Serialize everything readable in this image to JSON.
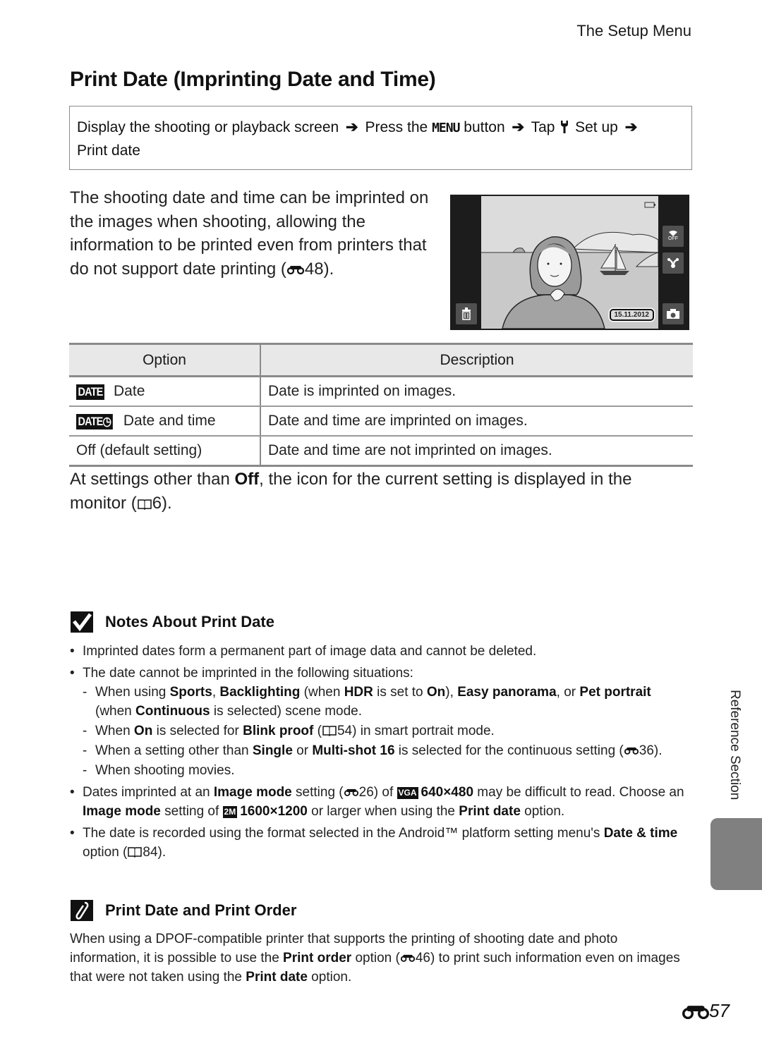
{
  "header": {
    "running_head": "The Setup Menu",
    "title": "Print Date (Imprinting Date and Time)"
  },
  "navigation": {
    "step1": "Display the shooting or playback screen",
    "step2_pre": "Press the",
    "menu_button": "MENU",
    "step2_post": "button",
    "step3_pre": "Tap",
    "step3_post": "Set up",
    "step4": "Print date",
    "icons": [
      "arrow-right-icon",
      "wrench-icon"
    ]
  },
  "intro": {
    "text": "The shooting date and time can be imprinted on the images when shooting, allowing the information to be printed even from printers that do not support date printing (",
    "ref": "48",
    "end": ")."
  },
  "camera_screen": {
    "date_stamp": "15.11.2012",
    "icons": [
      "battery-icon",
      "wifi-off-icon",
      "share-icon",
      "trash-icon",
      "camera-shutter-icon"
    ],
    "wifi_label": "OFF"
  },
  "table": {
    "headers": [
      "Option",
      "Description"
    ],
    "rows": [
      {
        "icon": "DATE",
        "option": "Date",
        "description": "Date is imprinted on images."
      },
      {
        "icon": "DATE◷",
        "option": "Date and time",
        "description": "Date and time are imprinted on images."
      },
      {
        "icon": "",
        "option": "Off (default setting)",
        "description": "Date and time are not imprinted on images."
      }
    ]
  },
  "para2": {
    "pre": "At settings other than ",
    "bold": "Off",
    "post": ", the icon for the current setting is displayed in the monitor (",
    "ref": "6",
    "end": ")."
  },
  "notes": {
    "heading": "Notes About Print Date",
    "b1": "Imprinted dates form a permanent part of image data and cannot be deleted.",
    "b2": "The date cannot be imprinted in the following situations:",
    "s1": {
      "t1": "When using ",
      "b1": "Sports",
      "t2": ", ",
      "b2": "Backlighting",
      "t3": " (when ",
      "b3": "HDR",
      "t4": " is set to ",
      "b4": "On",
      "t5": "), ",
      "b5": "Easy panorama",
      "t6": ", or ",
      "b6": "Pet portrait",
      "t7": " (when ",
      "b7": "Continuous",
      "t8": " is selected) scene mode."
    },
    "s2": {
      "t1": "When ",
      "b1": "On",
      "t2": " is selected for ",
      "b2": "Blink proof",
      "t3": " (",
      "ref": "54",
      "t4": ") in smart portrait mode."
    },
    "s3": {
      "t1": "When a setting other than ",
      "b1": "Single",
      "t2": " or ",
      "b2": "Multi-shot 16",
      "t3": " is selected for the continuous setting (",
      "ref": "36",
      "t4": ")."
    },
    "s4": "When shooting movies.",
    "b3": {
      "t1": "Dates imprinted at an ",
      "b1": "Image mode",
      "t2": " setting (",
      "ref": "26",
      "t3": ") of ",
      "icon1": "VGA",
      "b2": "640×480",
      "t4": " may be difficult to read. Choose an ",
      "b3": "Image mode",
      "t5": " setting of ",
      "icon2": "2M",
      "b4": "1600×1200",
      "t6": " or larger when using the ",
      "b5": "Print date",
      "t7": " option."
    },
    "b4": {
      "t1": "The date is recorded using the format selected in the Android™ platform setting menu's ",
      "b1": "Date & time",
      "t2": " option (",
      "ref": "84",
      "t3": ")."
    }
  },
  "tip": {
    "heading": "Print Date and Print Order",
    "t1": "When using a DPOF-compatible printer that supports the printing of shooting date and photo information, it is possible to use the ",
    "b1": "Print order",
    "t2": " option (",
    "ref": "46",
    "t3": ") to print such information even on images that were not taken using the ",
    "b2": "Print date",
    "t4": " option."
  },
  "sidebar": {
    "section_label": "Reference Section"
  },
  "footer": {
    "page_number": "57"
  }
}
